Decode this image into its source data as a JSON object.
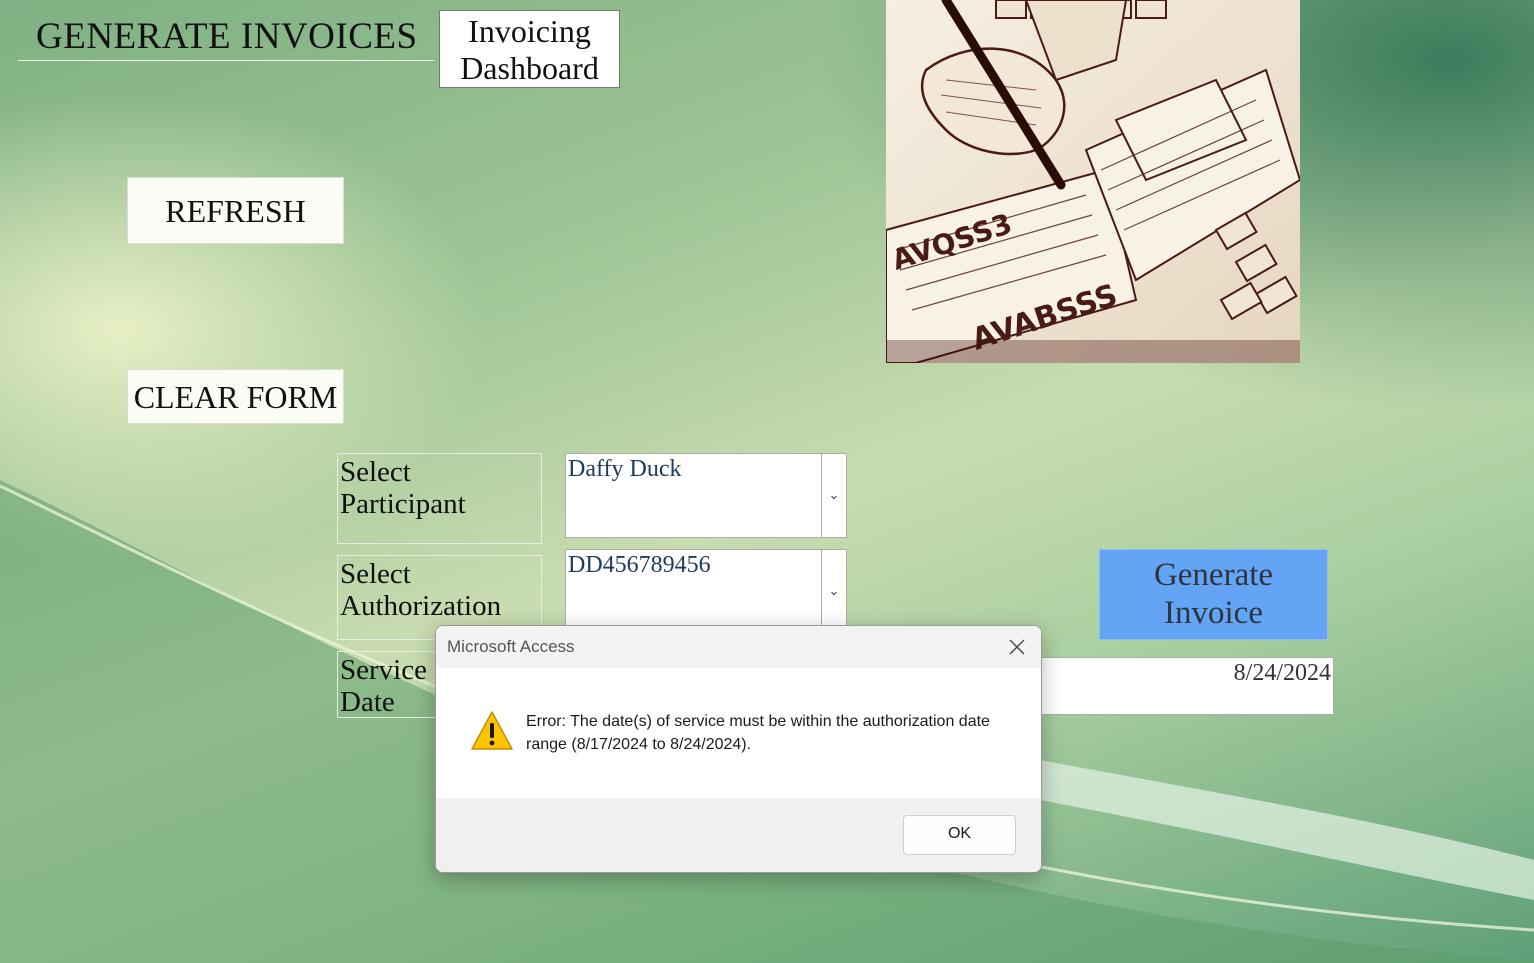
{
  "form": {
    "title": "GENERATE INVOICES",
    "dashboard_button_line1": "Invoicing",
    "dashboard_button_line2": "Dashboard",
    "refresh_label": "REFRESH",
    "clear_label": "CLEAR FORM",
    "participant_label_line1": "Select",
    "participant_label_line2": "Participant",
    "participant_value": "Daffy Duck",
    "authorization_label_line1": "Select",
    "authorization_label_line2": "Authorization",
    "authorization_value": "DD456789456",
    "service_date_label_line1": "Service",
    "service_date_label_line2": "Date",
    "service_date_value": "8/24/2024",
    "generate_line1": "Generate",
    "generate_line2": "Invoice"
  },
  "dialog": {
    "title": "Microsoft Access",
    "message": "Error: The date(s) of service must be within the authorization date range (8/17/2024 to 8/24/2024).",
    "ok_label": "OK",
    "icon": "warning-icon"
  },
  "image": {
    "icon": "invoice-sketch-illustration"
  },
  "colors": {
    "generate_button": "#64a4f4",
    "background_green": "#9cc494",
    "warning_yellow": "#ffc400"
  }
}
